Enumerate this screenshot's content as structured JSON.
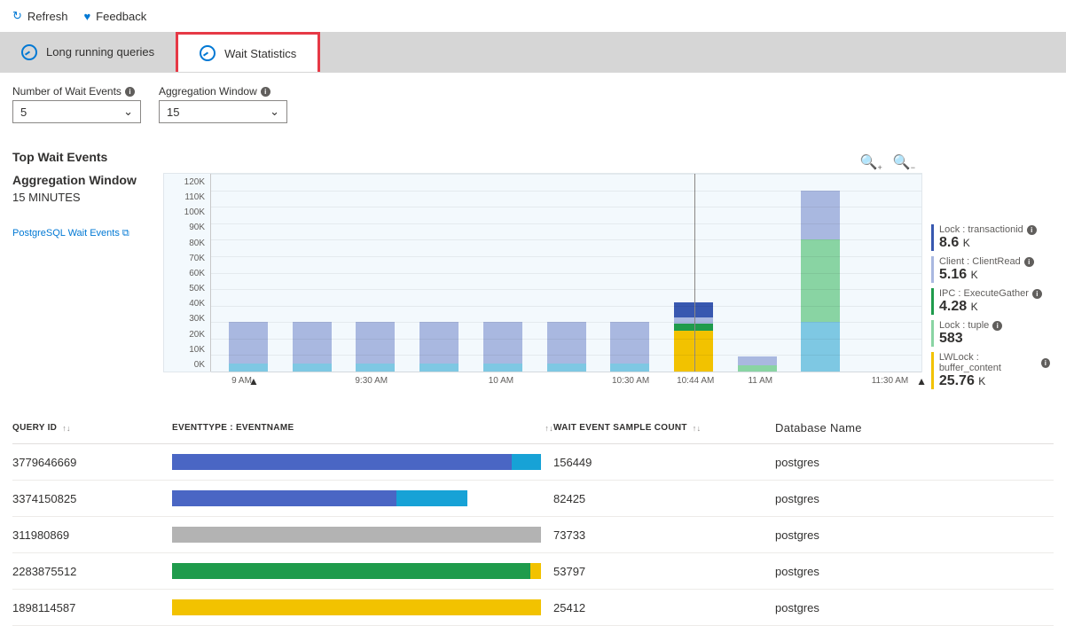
{
  "toolbar": {
    "refresh": "Refresh",
    "feedback": "Feedback"
  },
  "tabs": {
    "long": "Long running queries",
    "wait": "Wait Statistics"
  },
  "controls": {
    "numLabel": "Number of Wait Events",
    "numValue": "5",
    "aggLabel": "Aggregation Window",
    "aggValue": "15"
  },
  "section": "Top Wait Events",
  "meta": {
    "aggTitle": "Aggregation Window",
    "aggSub": "15 MINUTES",
    "link": "PostgreSQL Wait Events"
  },
  "chart_data": {
    "type": "bar",
    "ylim": [
      0,
      120000
    ],
    "yticks": [
      "120K",
      "110K",
      "100K",
      "90K",
      "80K",
      "70K",
      "60K",
      "50K",
      "40K",
      "30K",
      "20K",
      "10K",
      "0K"
    ],
    "xticks": [
      "9 AM",
      "",
      "9:30 AM",
      "",
      "10 AM",
      "",
      "10:30 AM",
      "10:44 AM",
      "11 AM",
      "",
      "11:30 AM"
    ],
    "colors": {
      "lock_tx": "#3858b0",
      "client": "#a9b8e0",
      "ipc": "#1f9b4c",
      "lock_tuple": "#89d4a3",
      "lwlock": "#7ec8e3",
      "yellow": "#f2c200"
    },
    "bars": [
      {
        "segs": [
          {
            "c": "lwlock",
            "v": 5
          },
          {
            "c": "client",
            "v": 25
          }
        ]
      },
      {
        "segs": [
          {
            "c": "lwlock",
            "v": 5
          },
          {
            "c": "client",
            "v": 25
          }
        ]
      },
      {
        "segs": [
          {
            "c": "lwlock",
            "v": 5
          },
          {
            "c": "client",
            "v": 25
          }
        ]
      },
      {
        "segs": [
          {
            "c": "lwlock",
            "v": 5
          },
          {
            "c": "client",
            "v": 25
          }
        ]
      },
      {
        "segs": [
          {
            "c": "lwlock",
            "v": 5
          },
          {
            "c": "client",
            "v": 25
          }
        ]
      },
      {
        "segs": [
          {
            "c": "lwlock",
            "v": 5
          },
          {
            "c": "client",
            "v": 25
          }
        ]
      },
      {
        "segs": [
          {
            "c": "lwlock",
            "v": 5
          },
          {
            "c": "client",
            "v": 25
          }
        ]
      },
      {
        "segs": [
          {
            "c": "yellow",
            "v": 25
          },
          {
            "c": "ipc",
            "v": 4
          },
          {
            "c": "client",
            "v": 4
          },
          {
            "c": "lock_tx",
            "v": 9
          }
        ]
      },
      {
        "segs": [
          {
            "c": "lock_tuple",
            "v": 4
          },
          {
            "c": "client",
            "v": 5
          }
        ]
      },
      {
        "segs": [
          {
            "c": "lwlock",
            "v": 30
          },
          {
            "c": "lock_tuple",
            "v": 50
          },
          {
            "c": "client",
            "v": 30
          }
        ]
      },
      {
        "segs": []
      }
    ]
  },
  "legend": [
    {
      "label": "Lock : transactionid",
      "value": "8.6",
      "unit": "K",
      "color": "#3858b0"
    },
    {
      "label": "Client : ClientRead",
      "value": "5.16",
      "unit": "K",
      "color": "#a9b8e0"
    },
    {
      "label": "IPC : ExecuteGather",
      "value": "4.28",
      "unit": "K",
      "color": "#1f9b4c"
    },
    {
      "label": "Lock : tuple",
      "value": "583",
      "unit": "",
      "color": "#89d4a3"
    },
    {
      "label": "LWLock : buffer_content",
      "value": "25.76",
      "unit": "K",
      "color": "#f2c200"
    }
  ],
  "table": {
    "headers": {
      "qid": "QUERY ID",
      "ev": "EVENTTYPE : EVENTNAME",
      "cnt": "WAIT EVENT SAMPLE COUNT",
      "db": "Database Name"
    },
    "rows": [
      {
        "qid": "3779646669",
        "count": "156449",
        "db": "postgres",
        "bar": [
          {
            "c": "#4a66c4",
            "w": 92
          },
          {
            "c": "#17a2d6",
            "w": 8
          }
        ],
        "full": 100
      },
      {
        "qid": "3374150825",
        "count": "82425",
        "db": "postgres",
        "bar": [
          {
            "c": "#4a66c4",
            "w": 76
          },
          {
            "c": "#17a2d6",
            "w": 24
          }
        ],
        "full": 80
      },
      {
        "qid": "311980869",
        "count": "73733",
        "db": "postgres",
        "bar": [
          {
            "c": "#b3b3b3",
            "w": 100
          }
        ],
        "full": 100
      },
      {
        "qid": "2283875512",
        "count": "53797",
        "db": "postgres",
        "bar": [
          {
            "c": "#1f9b4c",
            "w": 97
          },
          {
            "c": "#f2c200",
            "w": 3
          }
        ],
        "full": 100
      },
      {
        "qid": "1898114587",
        "count": "25412",
        "db": "postgres",
        "bar": [
          {
            "c": "#f2c200",
            "w": 100
          }
        ],
        "full": 100
      }
    ]
  }
}
